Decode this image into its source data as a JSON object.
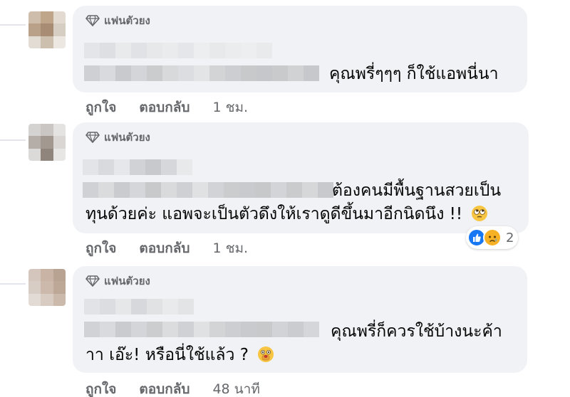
{
  "comments": [
    {
      "badge_label": "แฟนตัวยง",
      "lines": [
        "คุณพรี่ๆๆๆ ก็ใช้แอพนี่นา"
      ],
      "like_label": "ถูกใจ",
      "reply_label": "ตอบกลับ",
      "time": "1 ชม."
    },
    {
      "badge_label": "แฟนตัวยง",
      "lines": [
        "ต้องคนมีพื้นฐานสวยเป็น",
        "ทุนด้วยค่ะ แอพจะเป็นตัวดึงให้เราดูดีขึ้นมาอีกนิดนึง !!"
      ],
      "emoji": "rolling-eyes-emoji",
      "like_label": "ถูกใจ",
      "reply_label": "ตอบกลับ",
      "time": "1 ชม.",
      "reaction_count": "2",
      "reaction_icons": [
        "like-reaction-icon",
        "sad-reaction-icon"
      ]
    },
    {
      "badge_label": "แฟนตัวยง",
      "lines": [
        "คุณพรี่ก็ควรใช้บ้างนะค้า",
        "าา เอ๊ะ! หรือนี่ใช้แล้ว ?"
      ],
      "emoji": "face-with-hand-over-mouth-emoji",
      "like_label": "ถูกใจ",
      "reply_label": "ตอบกลับ",
      "time": "48 นาที"
    }
  ],
  "colors": {
    "bubble": "#f0f2f5",
    "meta_text": "#65676b",
    "like_blue": "#1877f2",
    "reaction_yellow": "#f7b125"
  }
}
